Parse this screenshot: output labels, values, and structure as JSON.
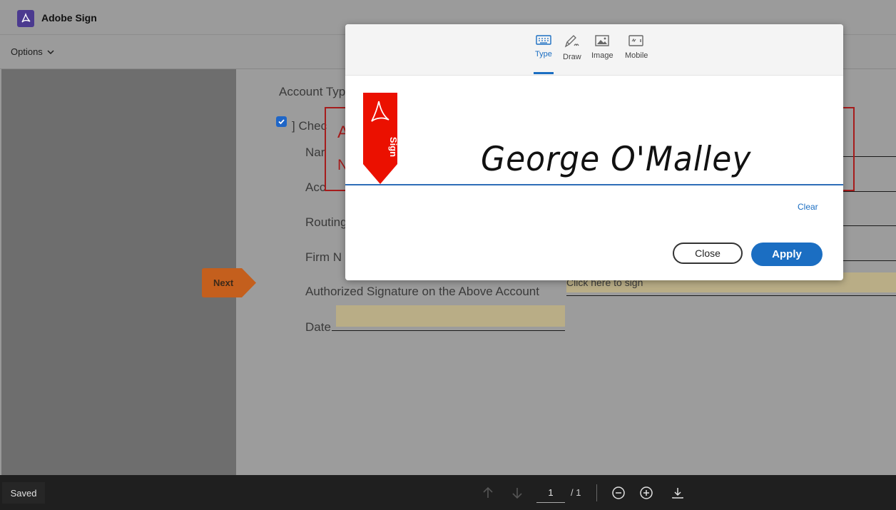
{
  "app": {
    "title": "Adobe Sign"
  },
  "toolbar": {
    "options_label": "Options"
  },
  "document": {
    "account_type_label": "Account Typ",
    "checkbox_label": "Chec",
    "checkbox_checked": true,
    "name_label": "Nar",
    "account_label": "Acc",
    "routing_label": "Routing",
    "firm_label": "Firm N",
    "auth_signature_label": "Authorized Signature on the Above Account",
    "date_label": "Date",
    "sign_field_label": "Click here to sign",
    "red_box_text_1": "A",
    "red_box_text_2": "N"
  },
  "next_tab": {
    "label": "Next",
    "color": "#c45f1d"
  },
  "modal": {
    "tabs": [
      {
        "label": "Type",
        "icon": "keyboard-icon",
        "active": true
      },
      {
        "label": "Draw",
        "icon": "pen-icon",
        "active": false
      },
      {
        "label": "Image",
        "icon": "image-icon",
        "active": false
      },
      {
        "label": "Mobile",
        "icon": "mobile-icon",
        "active": false
      }
    ],
    "bookmark_text": "Sign",
    "signature_text": "George O'Malley",
    "clear_label": "Clear",
    "close_label": "Close",
    "apply_label": "Apply",
    "accent_color": "#1b6ec2",
    "bookmark_color": "#eb1000"
  },
  "footer": {
    "saved_label": "Saved",
    "current_page": "1",
    "page_total": "/ 1"
  }
}
